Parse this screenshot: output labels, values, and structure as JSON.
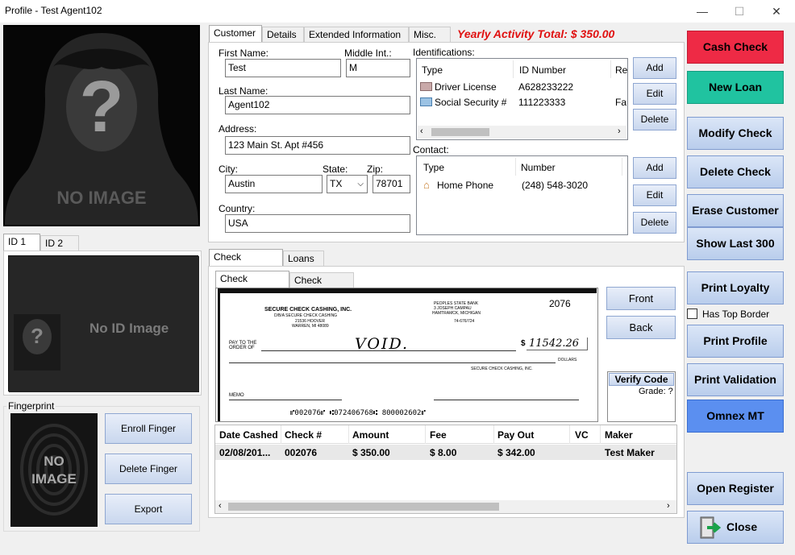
{
  "window": {
    "title": "Profile - Test Agent102",
    "minimize": "—",
    "maximize": "☐",
    "close": "✕"
  },
  "photo": {
    "caption": "NO IMAGE"
  },
  "id_tabs": [
    "ID 1",
    "ID 2"
  ],
  "id_image_caption": "No ID Image",
  "fingerprint": {
    "group_label": "Fingerprint",
    "image_caption_1": "NO",
    "image_caption_2": "IMAGE",
    "enroll": "Enroll Finger",
    "delete": "Delete Finger",
    "export": "Export"
  },
  "top_tabs": [
    "Customer",
    "Details",
    "Extended Information",
    "Misc."
  ],
  "yearly_total": "Yearly Activity Total: $ 350.00",
  "customer": {
    "first_name_label": "First Name:",
    "first_name": "Test",
    "middle_label": "Middle Int.:",
    "middle": "M",
    "last_name_label": "Last Name:",
    "last_name": "Agent102",
    "address_label": "Address:",
    "address": "123 Main St. Apt #456",
    "city_label": "City:",
    "city": "Austin",
    "state_label": "State:",
    "state": "TX",
    "zip_label": "Zip:",
    "zip": "78701",
    "country_label": "Country:",
    "country": "USA"
  },
  "identifications": {
    "label": "Identifications:",
    "columns": [
      "Type",
      "ID Number",
      "Re"
    ],
    "rows": [
      {
        "type": "Driver License",
        "number": "A628233222",
        "extra": ""
      },
      {
        "type": "Social Security #",
        "number": "111223333",
        "extra": "Fa"
      }
    ],
    "add": "Add",
    "edit": "Edit",
    "delete": "Delete"
  },
  "contact": {
    "label": "Contact:",
    "columns": [
      "Type",
      "Number"
    ],
    "rows": [
      {
        "type": "Home Phone",
        "number": "(248) 548-3020"
      }
    ],
    "add": "Add",
    "edit": "Edit",
    "delete": "Delete"
  },
  "lower_tabs": [
    "Check Cashing",
    "Loans"
  ],
  "check_tabs": [
    "Check Pictures",
    "Check Search"
  ],
  "check_image": {
    "company": "SECURE CHECK CASHING, INC.",
    "dba": "D/B/A SECURE CHECK CASHING",
    "street": "21536 HOOVER",
    "city": "WARREN, MI 48089",
    "bank": "PEOPLES STATE BANK",
    "bank_addr1": "3 JOSEPH CAMPAU",
    "bank_addr2": "HAMTRAMCK, MICHIGAN",
    "routing_frac": "74-676/724",
    "check_no": "2076",
    "pay_to": "PAY TO THE",
    "order_of": "ORDER OF",
    "written": "VOID.",
    "dollar_sign": "$",
    "amount": "11542.26",
    "dollars": "DOLLARS",
    "signer": "SECURE CHECK CASHING, INC.",
    "memo": "MEMO",
    "micr": "⑈002076⑈ ⑆072406768⑆ 800002602⑈"
  },
  "check_buttons": {
    "front": "Front",
    "back": "Back"
  },
  "verify": {
    "button": "Verify Code",
    "grade": "Grade: ?"
  },
  "checks_table": {
    "columns": [
      "Date Cashed",
      "Check #",
      "Amount",
      "Fee",
      "Pay Out",
      "VC",
      "Maker"
    ],
    "rows": [
      [
        "02/08/201...",
        "002076",
        "$ 350.00",
        "$ 8.00",
        "$ 342.00",
        "",
        "Test Maker"
      ]
    ]
  },
  "right_buttons": {
    "cash_check": "Cash Check",
    "new_loan": "New Loan",
    "modify_check": "Modify Check",
    "delete_check": "Delete Check",
    "erase_customer": "Erase Customer",
    "show_last": "Show Last 300",
    "print_loyalty": "Print Loyalty",
    "has_top_border": "Has Top Border",
    "print_profile": "Print Profile",
    "print_validation": "Print Validation",
    "omnex": "Omnex MT",
    "open_register": "Open Register",
    "close": "Close"
  },
  "colors": {
    "cash_check": "#ee2a45",
    "new_loan": "#20c3a0",
    "omnex": "#5b8ff0",
    "yearly": "#e01010"
  }
}
